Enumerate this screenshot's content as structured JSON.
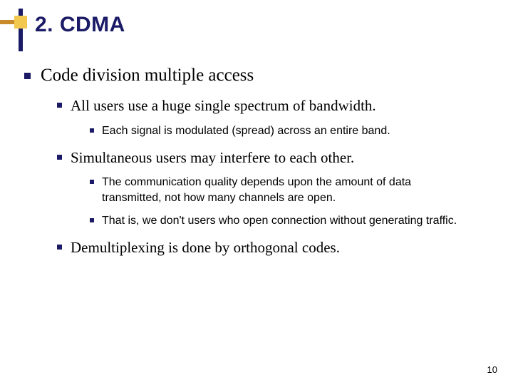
{
  "title": "2. CDMA",
  "page_number": "10",
  "l1": {
    "text": "Code division multiple access"
  },
  "l2": [
    {
      "text": "All users use a huge single spectrum of bandwidth."
    },
    {
      "text": "Simultaneous users may interfere to each other."
    },
    {
      "text": "Demultiplexing is done by orthogonal codes."
    }
  ],
  "l3a": [
    {
      "text": "Each signal is modulated (spread) across an entire band."
    }
  ],
  "l3b": [
    {
      "text": "The communication quality depends upon the amount of data transmitted, not how many channels are open."
    },
    {
      "text": "That is, we don't users who open connection without generating traffic."
    }
  ]
}
